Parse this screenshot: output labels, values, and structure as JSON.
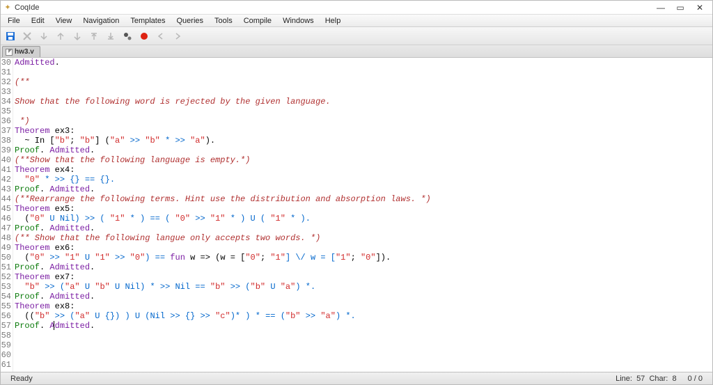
{
  "window": {
    "title": "CoqIde",
    "controls": {
      "min": "—",
      "max": "▭",
      "close": "✕"
    }
  },
  "menu": {
    "items": [
      "File",
      "Edit",
      "View",
      "Navigation",
      "Templates",
      "Queries",
      "Tools",
      "Compile",
      "Windows",
      "Help"
    ]
  },
  "tab": {
    "filename": "hw3.v"
  },
  "code": {
    "first_line_no": 30,
    "lines": [
      [
        {
          "t": "Admitted",
          "c": "c-kw"
        },
        {
          "t": ".",
          "c": ""
        }
      ],
      [],
      [
        {
          "t": "(**",
          "c": "c-cm"
        }
      ],
      [],
      [
        {
          "t": "Show that the following word is rejected by the given language.",
          "c": "c-cm"
        }
      ],
      [],
      [
        {
          "t": " *)",
          "c": "c-cm"
        }
      ],
      [
        {
          "t": "Theorem",
          "c": "c-kw"
        },
        {
          "t": " ex3:",
          "c": ""
        }
      ],
      [
        {
          "t": "  ~ In [",
          "c": ""
        },
        {
          "t": "\"b\"",
          "c": "c-str"
        },
        {
          "t": "; ",
          "c": ""
        },
        {
          "t": "\"b\"",
          "c": "c-str"
        },
        {
          "t": "] (",
          "c": ""
        },
        {
          "t": "\"a\"",
          "c": "c-str"
        },
        {
          "t": " >> ",
          "c": "c-sym"
        },
        {
          "t": "\"b\"",
          "c": "c-str"
        },
        {
          "t": " * >> ",
          "c": "c-sym"
        },
        {
          "t": "\"a\"",
          "c": "c-str"
        },
        {
          "t": ").",
          "c": ""
        }
      ],
      [
        {
          "t": "Proof",
          "c": "c-pf"
        },
        {
          "t": ". ",
          "c": ""
        },
        {
          "t": "Admitted",
          "c": "c-kw"
        },
        {
          "t": ".",
          "c": ""
        }
      ],
      [
        {
          "t": "(**Show that the following language is empty.*)",
          "c": "c-cm"
        }
      ],
      [
        {
          "t": "Theorem",
          "c": "c-kw"
        },
        {
          "t": " ex4:",
          "c": ""
        }
      ],
      [
        {
          "t": "  ",
          "c": ""
        },
        {
          "t": "\"0\"",
          "c": "c-str"
        },
        {
          "t": " * >> {} == {}.",
          "c": "c-sym"
        }
      ],
      [
        {
          "t": "Proof",
          "c": "c-pf"
        },
        {
          "t": ". ",
          "c": ""
        },
        {
          "t": "Admitted",
          "c": "c-kw"
        },
        {
          "t": ".",
          "c": ""
        }
      ],
      [
        {
          "t": "(**Rearrange the following terms. Hint use the distribution and absorption laws. *)",
          "c": "c-cm"
        }
      ],
      [
        {
          "t": "Theorem",
          "c": "c-kw"
        },
        {
          "t": " ex5:",
          "c": ""
        }
      ],
      [
        {
          "t": "  (",
          "c": ""
        },
        {
          "t": "\"0\"",
          "c": "c-str"
        },
        {
          "t": " U Nil) >> ( ",
          "c": "c-sym"
        },
        {
          "t": "\"1\"",
          "c": "c-str"
        },
        {
          "t": " * ) == ( ",
          "c": "c-sym"
        },
        {
          "t": "\"0\"",
          "c": "c-str"
        },
        {
          "t": " >> ",
          "c": "c-sym"
        },
        {
          "t": "\"1\"",
          "c": "c-str"
        },
        {
          "t": " * ) U ( ",
          "c": "c-sym"
        },
        {
          "t": "\"1\"",
          "c": "c-str"
        },
        {
          "t": " * ).",
          "c": "c-sym"
        }
      ],
      [
        {
          "t": "Proof",
          "c": "c-pf"
        },
        {
          "t": ". ",
          "c": ""
        },
        {
          "t": "Admitted",
          "c": "c-kw"
        },
        {
          "t": ".",
          "c": ""
        }
      ],
      [
        {
          "t": "(** Show that the following langue only accepts two words. *)",
          "c": "c-cm"
        }
      ],
      [
        {
          "t": "Theorem",
          "c": "c-kw"
        },
        {
          "t": " ex6:",
          "c": ""
        }
      ],
      [
        {
          "t": "  (",
          "c": ""
        },
        {
          "t": "\"0\"",
          "c": "c-str"
        },
        {
          "t": " >> ",
          "c": "c-sym"
        },
        {
          "t": "\"1\"",
          "c": "c-str"
        },
        {
          "t": " U ",
          "c": "c-sym"
        },
        {
          "t": "\"1\"",
          "c": "c-str"
        },
        {
          "t": " >> ",
          "c": "c-sym"
        },
        {
          "t": "\"0\"",
          "c": "c-str"
        },
        {
          "t": ") == ",
          "c": "c-sym"
        },
        {
          "t": "fun",
          "c": "c-fun"
        },
        {
          "t": " w => (w = [",
          "c": ""
        },
        {
          "t": "\"0\"",
          "c": "c-str"
        },
        {
          "t": "; ",
          "c": ""
        },
        {
          "t": "\"1\"",
          "c": "c-str"
        },
        {
          "t": "] \\/ w = [",
          "c": "c-sym"
        },
        {
          "t": "\"1\"",
          "c": "c-str"
        },
        {
          "t": "; ",
          "c": ""
        },
        {
          "t": "\"0\"",
          "c": "c-str"
        },
        {
          "t": "]).",
          "c": ""
        }
      ],
      [
        {
          "t": "Proof",
          "c": "c-pf"
        },
        {
          "t": ". ",
          "c": ""
        },
        {
          "t": "Admitted",
          "c": "c-kw"
        },
        {
          "t": ".",
          "c": ""
        }
      ],
      [
        {
          "t": "Theorem",
          "c": "c-kw"
        },
        {
          "t": " ex7:",
          "c": ""
        }
      ],
      [
        {
          "t": "  ",
          "c": ""
        },
        {
          "t": "\"b\"",
          "c": "c-str"
        },
        {
          "t": " >> (",
          "c": "c-sym"
        },
        {
          "t": "\"a\"",
          "c": "c-str"
        },
        {
          "t": " U ",
          "c": "c-sym"
        },
        {
          "t": "\"b\"",
          "c": "c-str"
        },
        {
          "t": " U Nil) * >> Nil == ",
          "c": "c-sym"
        },
        {
          "t": "\"b\"",
          "c": "c-str"
        },
        {
          "t": " >> (",
          "c": "c-sym"
        },
        {
          "t": "\"b\"",
          "c": "c-str"
        },
        {
          "t": " U ",
          "c": "c-sym"
        },
        {
          "t": "\"a\"",
          "c": "c-str"
        },
        {
          "t": ") *.",
          "c": "c-sym"
        }
      ],
      [
        {
          "t": "Proof",
          "c": "c-pf"
        },
        {
          "t": ". ",
          "c": ""
        },
        {
          "t": "Admitted",
          "c": "c-kw"
        },
        {
          "t": ".",
          "c": ""
        }
      ],
      [
        {
          "t": "Theorem",
          "c": "c-kw"
        },
        {
          "t": " ex8:",
          "c": ""
        }
      ],
      [
        {
          "t": "  ((",
          "c": ""
        },
        {
          "t": "\"b\"",
          "c": "c-str"
        },
        {
          "t": " >> (",
          "c": "c-sym"
        },
        {
          "t": "\"a\"",
          "c": "c-str"
        },
        {
          "t": " U {}) ) U (Nil >> {} >> ",
          "c": "c-sym"
        },
        {
          "t": "\"c\"",
          "c": "c-str"
        },
        {
          "t": ")* ) * == (",
          "c": "c-sym"
        },
        {
          "t": "\"b\"",
          "c": "c-str"
        },
        {
          "t": " >> ",
          "c": "c-sym"
        },
        {
          "t": "\"a\"",
          "c": "c-str"
        },
        {
          "t": ") *.",
          "c": "c-sym"
        }
      ],
      [
        {
          "t": "Proof",
          "c": "c-pf"
        },
        {
          "t": ". ",
          "c": ""
        },
        {
          "t": "Admitted",
          "c": "c-kw"
        },
        {
          "t": ".",
          "c": ""
        }
      ],
      [],
      [],
      [],
      []
    ],
    "cursor": {
      "line_index": 27,
      "col_ch": 8
    }
  },
  "status": {
    "left": "Ready",
    "line_label": "Line:",
    "line_value": "57",
    "char_label": "Char:",
    "char_value": "8",
    "coq_status": "0 / 0"
  }
}
